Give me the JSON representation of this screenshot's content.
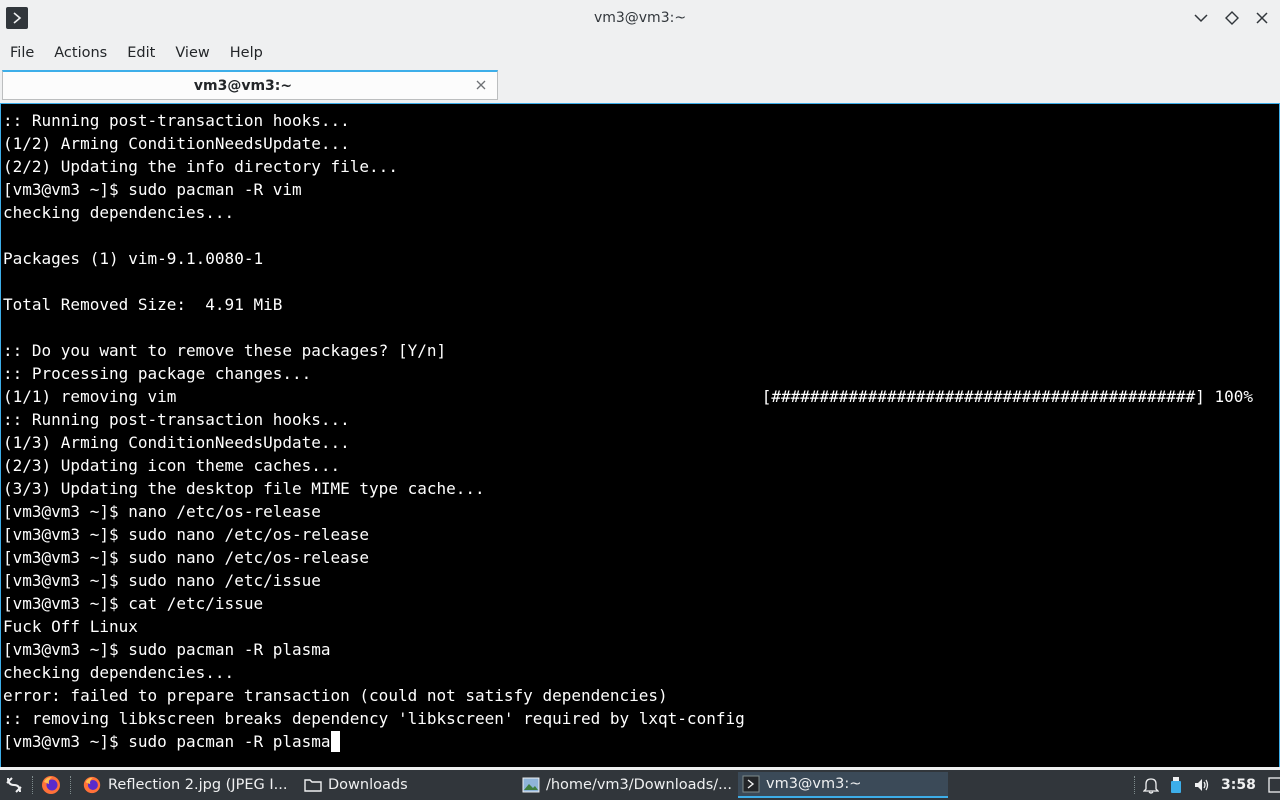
{
  "window": {
    "title": "vm3@vm3:~",
    "icons": {
      "app": "terminal-icon",
      "minimize": "chevron-down-icon",
      "maximize": "diamond-icon",
      "close": "close-icon"
    }
  },
  "menu": {
    "items": [
      "File",
      "Actions",
      "Edit",
      "View",
      "Help"
    ]
  },
  "tab": {
    "label": "vm3@vm3:~"
  },
  "terminal": {
    "lines": [
      ":: Running post-transaction hooks...",
      "(1/2) Arming ConditionNeedsUpdate...",
      "(2/2) Updating the info directory file...",
      "[vm3@vm3 ~]$ sudo pacman -R vim",
      "checking dependencies...",
      "",
      "Packages (1) vim-9.1.0080-1",
      "",
      "Total Removed Size:  4.91 MiB",
      "",
      ":: Do you want to remove these packages? [Y/n]",
      ":: Processing package changes...",
      "(1/1) removing vim",
      ":: Running post-transaction hooks...",
      "(1/3) Arming ConditionNeedsUpdate...",
      "(2/3) Updating icon theme caches...",
      "(3/3) Updating the desktop file MIME type cache...",
      "[vm3@vm3 ~]$ nano /etc/os-release",
      "[vm3@vm3 ~]$ sudo nano /etc/os-release",
      "[vm3@vm3 ~]$ sudo nano /etc/os-release",
      "[vm3@vm3 ~]$ sudo nano /etc/issue",
      "[vm3@vm3 ~]$ cat /etc/issue",
      "Fuck Off Linux",
      "[vm3@vm3 ~]$ sudo pacman -R plasma",
      "checking dependencies...",
      "error: failed to prepare transaction (could not satisfy dependencies)",
      ":: removing libkscreen breaks dependency 'libkscreen' required by lxqt-config",
      "[vm3@vm3 ~]$ sudo pacman -R plasma"
    ],
    "progress_line_index": 12,
    "progress_text": "[############################################] 100%"
  },
  "taskbar": {
    "start_icon": "lxqt-menu-icon",
    "quicklaunch_icon": "firefox-icon",
    "tasks": [
      {
        "label": "Reflection 2.jpg (JPEG I...",
        "icon": "firefox-icon",
        "active": false
      },
      {
        "label": "Downloads",
        "icon": "folder-icon",
        "active": false
      },
      {
        "label": "/home/vm3/Downloads/...",
        "icon": "image-viewer-icon",
        "active": false
      },
      {
        "label": "vm3@vm3:~",
        "icon": "terminal-icon",
        "active": true
      }
    ],
    "tray": {
      "icons": [
        "bell-icon",
        "usb-drive-icon",
        "volume-icon"
      ],
      "clock": "3:58",
      "show_desktop_icon": "show-desktop-icon"
    }
  }
}
